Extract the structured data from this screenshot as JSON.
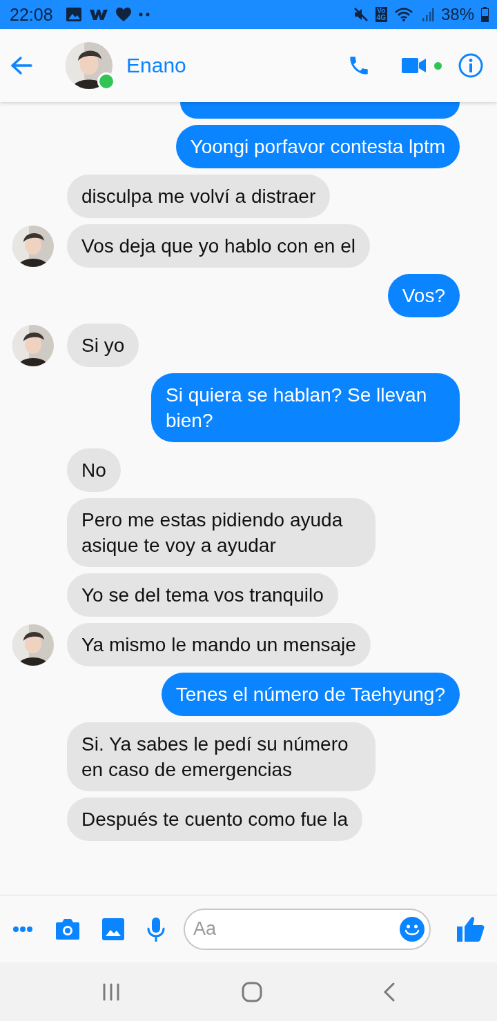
{
  "status_bar": {
    "time": "22:08",
    "network_top": "Vo",
    "network_bottom": "4G",
    "battery": "38%"
  },
  "header": {
    "contact_name": "Enano",
    "online": true,
    "active_call_dot": true
  },
  "messages": [
    {
      "kind": "sent"
    },
    {
      "kind": "sent",
      "text": "Yoongi porfavor contesta lptm"
    },
    {
      "kind": "received",
      "text": "disculpa me volví a distraer",
      "show_avatar": false
    },
    {
      "kind": "received",
      "text": "Vos deja que yo hablo con en el",
      "show_avatar": true
    },
    {
      "kind": "sent",
      "text": "Vos?"
    },
    {
      "kind": "received",
      "text": "Si yo",
      "show_avatar": true
    },
    {
      "kind": "sent",
      "text": "Si quiera se hablan? Se llevan bien?"
    },
    {
      "kind": "received",
      "text": "No",
      "show_avatar": false
    },
    {
      "kind": "received",
      "text": "Pero me estas pidiendo ayuda asique te voy a ayudar",
      "show_avatar": false
    },
    {
      "kind": "received",
      "text": "Yo se del tema vos tranquilo",
      "show_avatar": false
    },
    {
      "kind": "received",
      "text": "Ya mismo le mando un mensaje",
      "show_avatar": true
    },
    {
      "kind": "sent",
      "text": "Tenes el número de Taehyung?"
    },
    {
      "kind": "received",
      "text": "Si. Ya sabes le pedí su número en caso de emergencias",
      "show_avatar": false
    },
    {
      "kind": "received",
      "text": "Después te cuento como fue la",
      "show_avatar": false
    }
  ],
  "composer": {
    "placeholder": "Aa"
  }
}
